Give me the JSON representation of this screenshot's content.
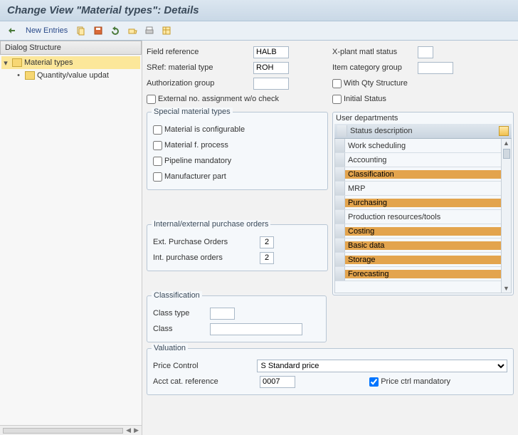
{
  "title": "Change View \"Material types\": Details",
  "toolbar": {
    "new_entries": "New Entries"
  },
  "dialog_structure": {
    "title": "Dialog Structure",
    "root": "Material types",
    "child": "Quantity/value updat"
  },
  "top_fields": {
    "field_reference_lbl": "Field reference",
    "field_reference_val": "HALB",
    "sref_lbl": "SRef: material type",
    "sref_val": "ROH",
    "auth_lbl": "Authorization group",
    "auth_val": "",
    "ext_no_lbl": "External no. assignment w/o check",
    "xplant_lbl": "X-plant matl status",
    "xplant_val": "",
    "itemcat_lbl": "Item category group",
    "itemcat_val": "",
    "withqty_lbl": "With Qty Structure",
    "initial_lbl": "Initial Status"
  },
  "special": {
    "legend": "Special material types",
    "configurable": "Material is configurable",
    "process": "Material f. process",
    "pipeline": "Pipeline mandatory",
    "manufacturer": "Manufacturer part"
  },
  "user_dept": {
    "legend": "User departments",
    "header": "Status description",
    "items": [
      {
        "label": "Work scheduling",
        "selected": false
      },
      {
        "label": "Accounting",
        "selected": false
      },
      {
        "label": "Classification",
        "selected": true
      },
      {
        "label": "MRP",
        "selected": false
      },
      {
        "label": "Purchasing",
        "selected": true
      },
      {
        "label": "Production resources/tools",
        "selected": false
      },
      {
        "label": "Costing",
        "selected": true
      },
      {
        "label": "Basic data",
        "selected": true
      },
      {
        "label": "Storage",
        "selected": true
      },
      {
        "label": "Forecasting",
        "selected": true
      }
    ]
  },
  "purchase": {
    "legend": "Internal/external purchase orders",
    "ext_lbl": "Ext. Purchase Orders",
    "ext_val": "2",
    "int_lbl": "Int. purchase orders",
    "int_val": "2"
  },
  "classification": {
    "legend": "Classification",
    "type_lbl": "Class type",
    "type_val": "",
    "class_lbl": "Class",
    "class_val": ""
  },
  "valuation": {
    "legend": "Valuation",
    "price_lbl": "Price Control",
    "price_val": "S Standard price",
    "acct_lbl": "Acct cat. reference",
    "acct_val": "0007",
    "mand_lbl": "Price ctrl mandatory"
  }
}
